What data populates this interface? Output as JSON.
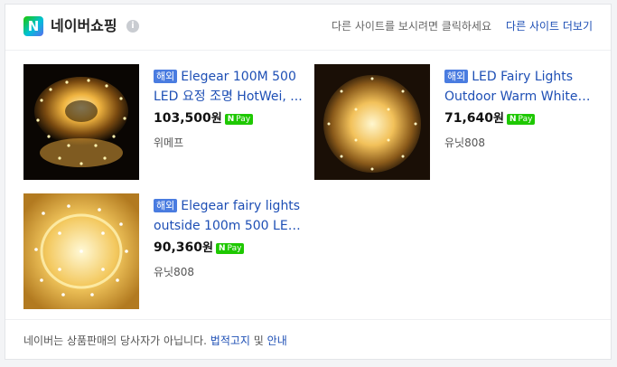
{
  "header": {
    "logo_letter": "N",
    "title": "네이버쇼핑",
    "info_symbol": "i",
    "hint": "다른 사이트를 보시려면 클릭하세요",
    "more_link": "다른 사이트 더보기"
  },
  "products": [
    {
      "badge": "해외",
      "name": "Elegear 100M 500 LED 요정 조명 HotWei, ...",
      "price": "103,500",
      "currency": "원",
      "npay_n": "N",
      "npay_label": "Pay",
      "seller": "위메프"
    },
    {
      "badge": "해외",
      "name": "LED Fairy Lights Outdoor Warm White 100...",
      "price": "71,640",
      "currency": "원",
      "npay_n": "N",
      "npay_label": "Pay",
      "seller": "유닛808"
    },
    {
      "badge": "해외",
      "name": "Elegear fairy lights outside 100m 500 LEDs ...",
      "price": "90,360",
      "currency": "원",
      "npay_n": "N",
      "npay_label": "Pay",
      "seller": "유닛808"
    }
  ],
  "footer": {
    "text": "네이버는 상품판매의 당사자가 아닙니다.",
    "link1": "법적고지",
    "conj": "및",
    "link2": "안내"
  }
}
